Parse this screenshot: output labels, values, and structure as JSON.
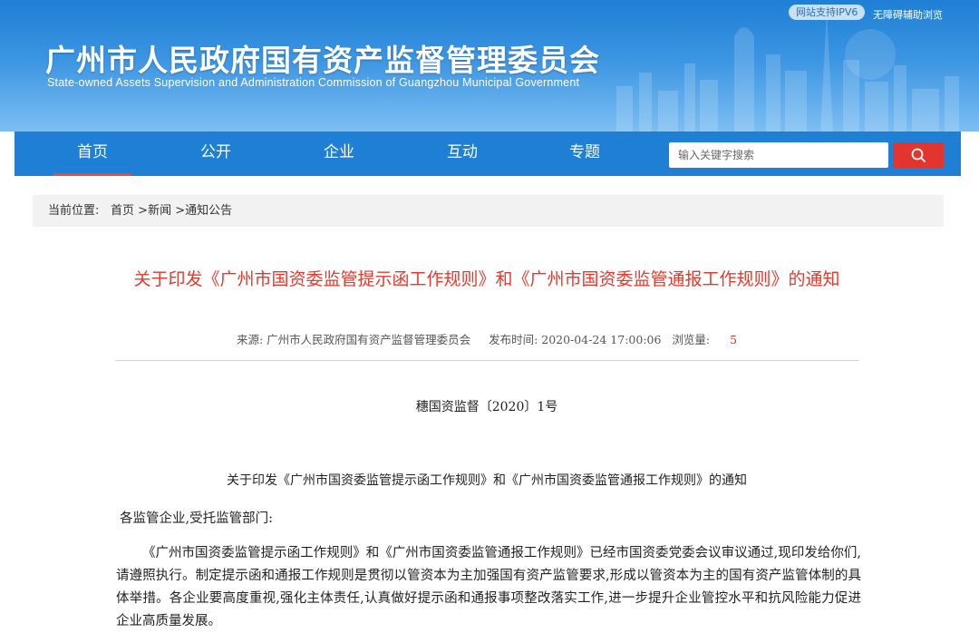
{
  "header": {
    "ipv6_badge": "网站支持IPV6",
    "accessibility_link": "无障碍辅助浏览",
    "site_title": "广州市人民政府国有资产监督管理委员会",
    "site_subtitle": "State-owned  Assets Supervision and Administration Commission of Guangzhou Municipal Government"
  },
  "nav": {
    "items": [
      {
        "label": "首页",
        "active": true
      },
      {
        "label": "公开"
      },
      {
        "label": "企业"
      },
      {
        "label": "互动"
      },
      {
        "label": "专题"
      }
    ]
  },
  "search": {
    "placeholder": "输入关键字搜索",
    "button_icon": "search-icon"
  },
  "breadcrumb": {
    "label": "当前位置:",
    "items": [
      "首页",
      "新闻",
      "通知公告"
    ],
    "separator": ">"
  },
  "article": {
    "title": "关于印发《广州市国资委监管提示函工作规则》和《广州市国资委监管通报工作规则》的通知",
    "source_label": "来源:",
    "source_value": "广州市人民政府国有资产监督管理委员会",
    "publish_label": "发布时间:",
    "publish_value": "2020-04-24 17:00:06",
    "views_label": "浏览量:",
    "views_value": "5",
    "doc_number": "穗国资监督〔2020〕1号",
    "doc_heading": "关于印发《广州市国资委监管提示函工作规则》和《广州市国资委监管通报工作规则》的通知",
    "salutation": "各监管企业,受托监管部门:",
    "body": "《广州市国资委监管提示函工作规则》和《广州市国资委监管通报工作规则》已经市国资委党委会议审议通过,现印发给你们,请遵照执行。制定提示函和通报工作规则是贯彻以管资本为主加强国有资产监管要求,形成以管资本为主的国有资产监管体制的具体举措。各企业要高度重视,强化主体责任,认真做好提示函和通报事项整改落实工作,进一步提升企业管控水平和抗风险能力促进企业高质量发展。"
  },
  "colors": {
    "primary_blue": "#1f7fd4",
    "accent_red": "#e3352f",
    "title_red": "#e33a2d"
  }
}
